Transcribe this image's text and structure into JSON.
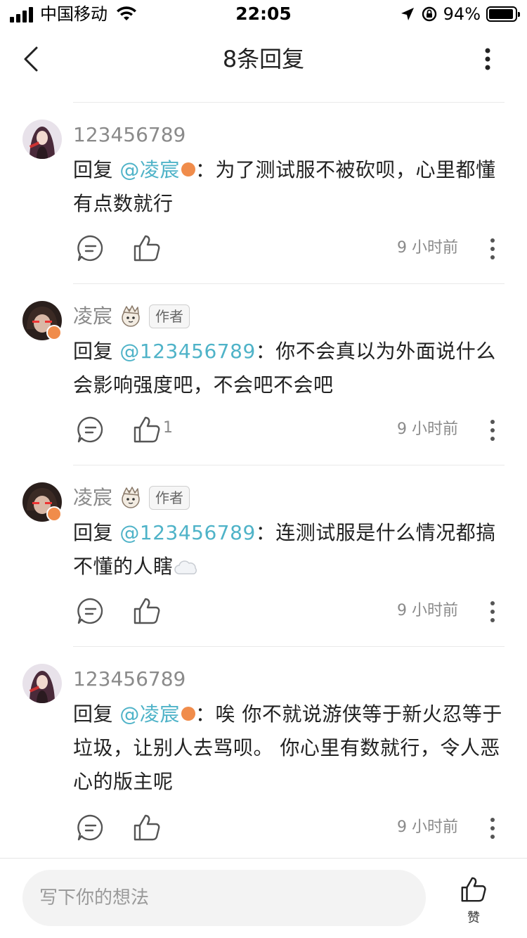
{
  "status_bar": {
    "carrier": "中国移动",
    "time": "22:05",
    "battery_percent": "94%",
    "battery_level": 0.94
  },
  "header": {
    "title": "8条回复",
    "back_icon": "back-chevron-icon",
    "more_icon": "more-vertical-icon"
  },
  "comments": [
    {
      "username": "123456789",
      "reply_prefix": "回复",
      "mention": "@凌宸",
      "separator": "：",
      "text": "为了测试服不被砍呗，心里都懂有点数就行",
      "like_count": "",
      "time": "9 小时前"
    },
    {
      "username": "凌宸",
      "author_tag": "作者",
      "reply_prefix": "回复",
      "mention": "@123456789",
      "separator": "：",
      "text": "你不会真以为外面说什么会影响强度吧，不会吧不会吧",
      "like_count": "1",
      "time": "9 小时前"
    },
    {
      "username": "凌宸",
      "author_tag": "作者",
      "reply_prefix": "回复",
      "mention": "@123456789",
      "separator": "：",
      "text": "连测试服是什么情况都搞不懂的人瞎",
      "like_count": "",
      "time": "9 小时前"
    },
    {
      "username": "123456789",
      "reply_prefix": "回复",
      "mention": "@凌宸",
      "separator": "：",
      "text": "唉 你不就说游侠等于新火忍等于垃圾，让别人去骂呗。 你心里有数就行，令人恶心的版主呢",
      "like_count": "",
      "time": "9 小时前"
    }
  ],
  "bottom_bar": {
    "input_placeholder": "写下你的想法",
    "like_label": "赞"
  },
  "colors": {
    "mention": "#4fb3c8",
    "badge": "#f08c4b",
    "secondary_text": "#8a8a8a"
  }
}
